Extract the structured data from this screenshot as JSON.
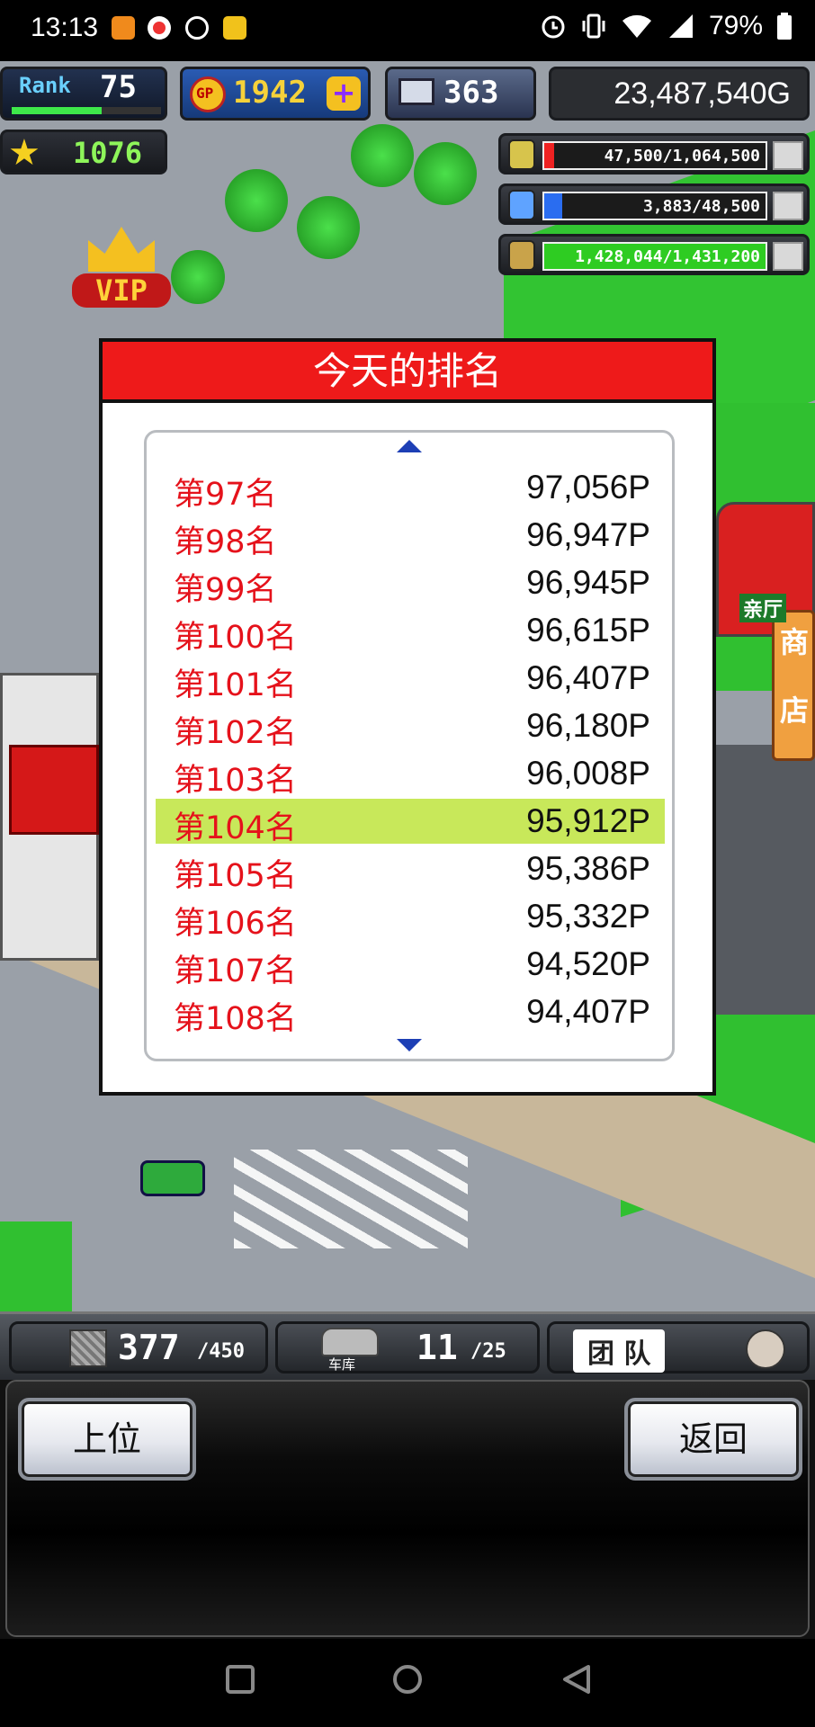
{
  "status_bar": {
    "time": "13:13",
    "battery_percent": "79%",
    "icons": [
      "app-notification-icon",
      "weibo-icon",
      "app-notification-icon",
      "app-notification-icon",
      "alarm-icon",
      "vibrate-icon",
      "wifi-icon",
      "signal-icon",
      "battery-icon"
    ]
  },
  "hud": {
    "rank_label": "Rank",
    "rank_value": "75",
    "gp_label": "GP",
    "gp_value": "1942",
    "computer_value": "363",
    "money": "23,487,540G",
    "star_value": "1076",
    "vip_label": "VIP",
    "resources": [
      {
        "icon": "coin-stack-icon",
        "text": "47,500/1,064,500",
        "fill": 0.045,
        "color": "#ee2222"
      },
      {
        "icon": "fuel-bottle-icon",
        "text": "3,883/48,500",
        "fill": 0.08,
        "color": "#2a6df0"
      },
      {
        "icon": "wheat-icon",
        "text": "1,428,044/1,431,200",
        "fill": 0.998,
        "color": "#2ecc22"
      }
    ],
    "shop_sign_top": "商",
    "shop_sign_bottom": "店",
    "hall_sign": "亲厅"
  },
  "dialog": {
    "title": "今天的排名",
    "rows": [
      {
        "rank": "第97名",
        "points": "97,056P",
        "highlighted": false
      },
      {
        "rank": "第98名",
        "points": "96,947P",
        "highlighted": false
      },
      {
        "rank": "第99名",
        "points": "96,945P",
        "highlighted": false
      },
      {
        "rank": "第100名",
        "points": "96,615P",
        "highlighted": false
      },
      {
        "rank": "第101名",
        "points": "96,407P",
        "highlighted": false
      },
      {
        "rank": "第102名",
        "points": "96,180P",
        "highlighted": false
      },
      {
        "rank": "第103名",
        "points": "96,008P",
        "highlighted": false
      },
      {
        "rank": "第104名",
        "points": "95,912P",
        "highlighted": true
      },
      {
        "rank": "第105名",
        "points": "95,386P",
        "highlighted": false
      },
      {
        "rank": "第106名",
        "points": "95,332P",
        "highlighted": false
      },
      {
        "rank": "第107名",
        "points": "94,520P",
        "highlighted": false
      },
      {
        "rank": "第108名",
        "points": "94,407P",
        "highlighted": false
      }
    ],
    "highlight_color": "#c8e85a"
  },
  "bottom_counters": {
    "storage_current": "377",
    "storage_max": "/450",
    "garage_label": "车库",
    "garage_current": "11",
    "garage_max": "/25",
    "team_label": "团 队"
  },
  "buttons": {
    "top_rank": "上位",
    "back": "返回"
  },
  "nav_icons": [
    "recents-square-icon",
    "home-circle-icon",
    "back-triangle-icon"
  ]
}
